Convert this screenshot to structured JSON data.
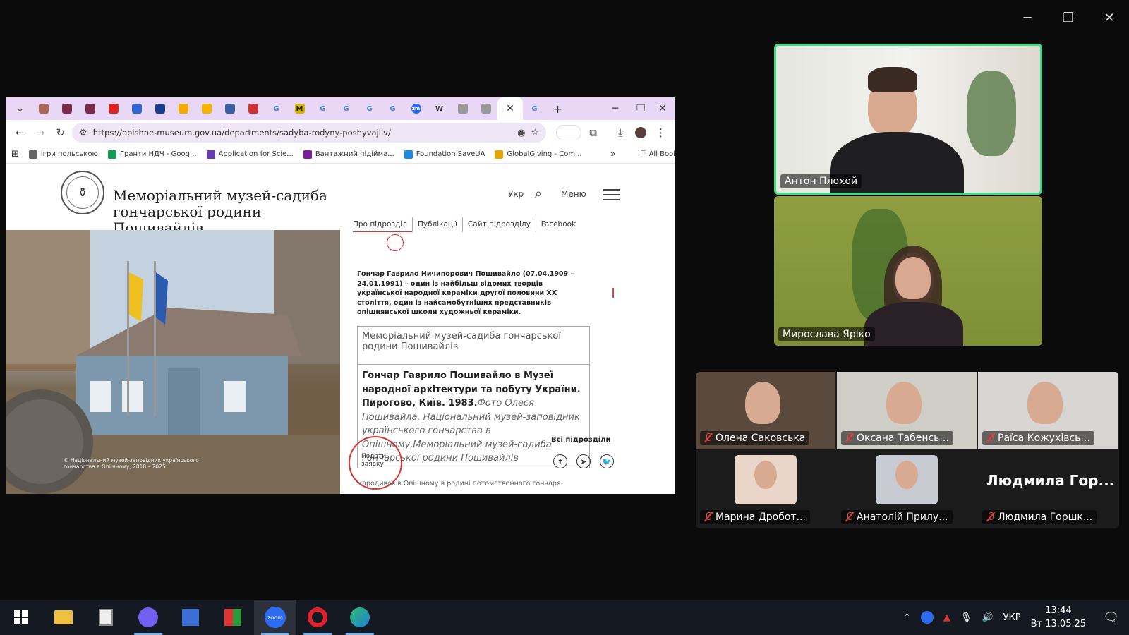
{
  "window_controls": {
    "minimize": "─",
    "restore": "❐",
    "close": "✕"
  },
  "browser": {
    "tabs": [
      {
        "icon": "chevron-down-icon",
        "color": "#666"
      },
      {
        "icon": "bookmark-pin-icon",
        "color": "#a65"
      },
      {
        "icon": "site-icon-1",
        "color": "#7a2a4a"
      },
      {
        "icon": "site-icon-2",
        "color": "#7a2a4a"
      },
      {
        "icon": "japan-flag-icon",
        "color": "#d22"
      },
      {
        "icon": "site-icon-3",
        "color": "#3367d6"
      },
      {
        "icon": "contrast-icon",
        "color": "#1a3c8a"
      },
      {
        "icon": "drive-icon",
        "color": "#f2a900"
      },
      {
        "icon": "slides-icon",
        "color": "#f4b400"
      },
      {
        "icon": "site-icon-4",
        "color": "#3b5fa0"
      },
      {
        "icon": "gmail-icon",
        "color": "#c33"
      },
      {
        "icon": "google-icon",
        "color": "#4285f4"
      },
      {
        "icon": "m-icon",
        "color": "#d4b400"
      },
      {
        "icon": "google-icon",
        "color": "#4285f4"
      },
      {
        "icon": "google-icon",
        "color": "#4285f4"
      },
      {
        "icon": "google-icon",
        "color": "#4285f4"
      },
      {
        "icon": "google-icon",
        "color": "#4285f4"
      },
      {
        "icon": "zoom-icon",
        "color": "#2d6cf0"
      },
      {
        "icon": "wikipedia-icon",
        "color": "#333"
      },
      {
        "icon": "site-icon-5",
        "color": "#999"
      },
      {
        "icon": "site-icon-6",
        "color": "#999"
      }
    ],
    "tab_glyphs": {
      "google": "G",
      "m": "M",
      "wiki": "W",
      "zoom": "zm",
      "new_tab": "+",
      "close": "✕"
    },
    "url": "https://opishne-museum.gov.ua/departments/sadyba-rodyny-poshyvajliv/",
    "bookmarks": [
      {
        "label": "ігри польською",
        "color": "#666"
      },
      {
        "label": "Гранти НДЧ - Goog...",
        "color": "#0f9d58"
      },
      {
        "label": "Application for Scie...",
        "color": "#673ab7"
      },
      {
        "label": "Вантажний підійма...",
        "color": "#7b1fa2"
      },
      {
        "label": "Foundation SaveUA",
        "color": "#1e88e5"
      },
      {
        "label": "GlobalGiving - Com...",
        "color": "#e6a400"
      }
    ],
    "more_bookmarks": "»",
    "all_bookmarks": "All Bookmarks"
  },
  "site": {
    "title_line1": "Меморіальний музей-садиба",
    "title_line2": "гончарської родини Пошивайлів",
    "lang": "Укр",
    "menu": "Меню",
    "subtabs": [
      "Про підрозділ",
      "Публікації",
      "Сайт підрозділу",
      "Facebook"
    ],
    "bio": "Гончар Гаврило Ничипорович Пошивайло (07.04.1909 – 24.01.1991) – один із найбільш відомих творців української народної кераміки другої половини ХХ століття, один із найсамобутніших представників опішнянської школи художньої кераміки.",
    "img_alt": "Меморіальний музей-садиба гончарської родини Пошивайлів",
    "caption_bold": "Гончар Гаврило Пошивайло в Музеї народної архітектури та побуту України. Пирогово, Київ. 1983.",
    "caption_italic": "Фото Олеся Пошивайла. Національний музей-заповідник українського гончарства в Опішному,Меморіальний музей-садиба гончарської родини Пошивайлів",
    "all_departments": "Всі підрозділи",
    "feedback": "Подати заявку",
    "hero_copyright": "© Національний музей-заповідник українського гончарства в Опішному, 2010 – 2025",
    "bottom_text": "Народився в Опішному в родині потомственного гончаря-"
  },
  "participants": {
    "main": [
      {
        "name": "Антон Плохой",
        "active_speaker": true
      },
      {
        "name": "Мирослава Ярiко",
        "active_speaker": false
      }
    ],
    "gallery": [
      {
        "name": "Олена Саковська",
        "muted": true
      },
      {
        "name": "Оксана Табенсь...",
        "muted": true
      },
      {
        "name": "Раїса Кожухівсь...",
        "muted": true
      },
      {
        "name": "Марина Дробот...",
        "muted": true
      },
      {
        "name": "Анатолій Прилу...",
        "muted": true
      },
      {
        "name": "Людмила Горшк...",
        "muted": true
      }
    ],
    "no_video_label": "Людмила  Гор..."
  },
  "taskbar": {
    "apps": [
      "start",
      "file-explorer",
      "calculator",
      "viber",
      "save",
      "app-red-green",
      "zoom",
      "opera",
      "edge"
    ],
    "zoom_label": "zoom",
    "lang": "УКР",
    "time": "13:44",
    "date": "Вт 13.05.25"
  }
}
